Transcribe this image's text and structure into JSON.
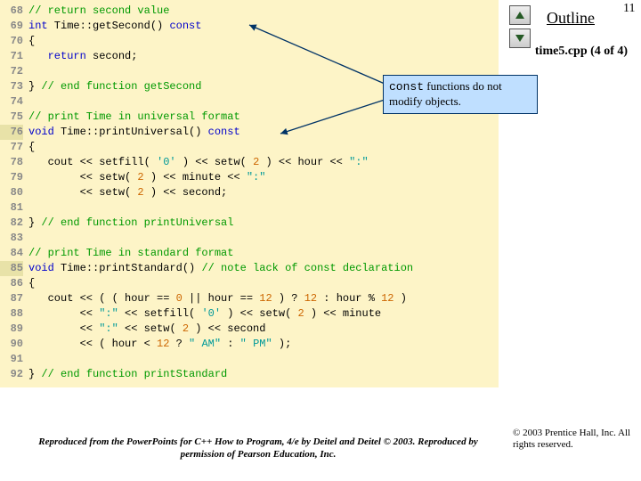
{
  "page_number": "11",
  "outline_label": "Outline",
  "file_label": "time5.cpp (4 of 4)",
  "callout": {
    "mono": "const",
    "rest": " functions do not modify objects."
  },
  "copyright": "© 2003 Prentice Hall, Inc. All rights reserved.",
  "reproduction": "Reproduced from the PowerPoints for C++ How to Program, 4/e by Deitel and Deitel © 2003. Reproduced by permission of Pearson Education, Inc.",
  "code": [
    {
      "n": "68",
      "s": [
        [
          "c-comment",
          "// return second value"
        ]
      ]
    },
    {
      "n": "69",
      "s": [
        [
          "c-key",
          "int"
        ],
        [
          "c-plain",
          " Time::getSecond() "
        ],
        [
          "c-key",
          "const"
        ]
      ]
    },
    {
      "n": "70",
      "s": [
        [
          "c-plain",
          "{"
        ]
      ]
    },
    {
      "n": "71",
      "s": [
        [
          "c-plain",
          "   "
        ],
        [
          "c-key",
          "return"
        ],
        [
          "c-plain",
          " second;"
        ]
      ]
    },
    {
      "n": "72",
      "s": [
        [
          "c-plain",
          ""
        ]
      ]
    },
    {
      "n": "73",
      "s": [
        [
          "c-plain",
          "} "
        ],
        [
          "c-comment",
          "// end function getSecond"
        ]
      ]
    },
    {
      "n": "74",
      "s": [
        [
          "c-plain",
          ""
        ]
      ]
    },
    {
      "n": "75",
      "s": [
        [
          "c-comment",
          "// print Time in universal format"
        ]
      ]
    },
    {
      "n": "76",
      "hl": true,
      "s": [
        [
          "c-key",
          "void"
        ],
        [
          "c-plain",
          " Time::printUniversal() "
        ],
        [
          "c-key",
          "const"
        ]
      ]
    },
    {
      "n": "77",
      "s": [
        [
          "c-plain",
          "{"
        ]
      ]
    },
    {
      "n": "78",
      "s": [
        [
          "c-plain",
          "   cout << setfill( "
        ],
        [
          "c-str",
          "'0'"
        ],
        [
          "c-plain",
          " ) << setw( "
        ],
        [
          "c-num",
          "2"
        ],
        [
          "c-plain",
          " ) << hour << "
        ],
        [
          "c-str",
          "\":\""
        ]
      ]
    },
    {
      "n": "79",
      "s": [
        [
          "c-plain",
          "        << setw( "
        ],
        [
          "c-num",
          "2"
        ],
        [
          "c-plain",
          " ) << minute << "
        ],
        [
          "c-str",
          "\":\""
        ]
      ]
    },
    {
      "n": "80",
      "s": [
        [
          "c-plain",
          "        << setw( "
        ],
        [
          "c-num",
          "2"
        ],
        [
          "c-plain",
          " ) << second;"
        ]
      ]
    },
    {
      "n": "81",
      "s": [
        [
          "c-plain",
          ""
        ]
      ]
    },
    {
      "n": "82",
      "s": [
        [
          "c-plain",
          "} "
        ],
        [
          "c-comment",
          "// end function printUniversal"
        ]
      ]
    },
    {
      "n": "83",
      "s": [
        [
          "c-plain",
          ""
        ]
      ]
    },
    {
      "n": "84",
      "s": [
        [
          "c-comment",
          "// print Time in standard format"
        ]
      ]
    },
    {
      "n": "85",
      "hl": true,
      "s": [
        [
          "c-key",
          "void"
        ],
        [
          "c-plain",
          " Time::printStandard() "
        ],
        [
          "c-comment",
          "// note lack of const declaration"
        ]
      ]
    },
    {
      "n": "86",
      "s": [
        [
          "c-plain",
          "{"
        ]
      ]
    },
    {
      "n": "87",
      "s": [
        [
          "c-plain",
          "   cout << ( ( hour == "
        ],
        [
          "c-num",
          "0"
        ],
        [
          "c-plain",
          " || hour == "
        ],
        [
          "c-num",
          "12"
        ],
        [
          "c-plain",
          " ) ? "
        ],
        [
          "c-num",
          "12"
        ],
        [
          "c-plain",
          " : hour % "
        ],
        [
          "c-num",
          "12"
        ],
        [
          "c-plain",
          " )"
        ]
      ]
    },
    {
      "n": "88",
      "s": [
        [
          "c-plain",
          "        << "
        ],
        [
          "c-str",
          "\":\""
        ],
        [
          "c-plain",
          " << setfill( "
        ],
        [
          "c-str",
          "'0'"
        ],
        [
          "c-plain",
          " ) << setw( "
        ],
        [
          "c-num",
          "2"
        ],
        [
          "c-plain",
          " ) << minute"
        ]
      ]
    },
    {
      "n": "89",
      "s": [
        [
          "c-plain",
          "        << "
        ],
        [
          "c-str",
          "\":\""
        ],
        [
          "c-plain",
          " << setw( "
        ],
        [
          "c-num",
          "2"
        ],
        [
          "c-plain",
          " ) << second"
        ]
      ]
    },
    {
      "n": "90",
      "s": [
        [
          "c-plain",
          "        << ( hour < "
        ],
        [
          "c-num",
          "12"
        ],
        [
          "c-plain",
          " ? "
        ],
        [
          "c-str",
          "\" AM\""
        ],
        [
          "c-plain",
          " : "
        ],
        [
          "c-str",
          "\" PM\""
        ],
        [
          "c-plain",
          " );"
        ]
      ]
    },
    {
      "n": "91",
      "s": [
        [
          "c-plain",
          ""
        ]
      ]
    },
    {
      "n": "92",
      "s": [
        [
          "c-plain",
          "} "
        ],
        [
          "c-comment",
          "// end function printStandard"
        ]
      ]
    }
  ]
}
